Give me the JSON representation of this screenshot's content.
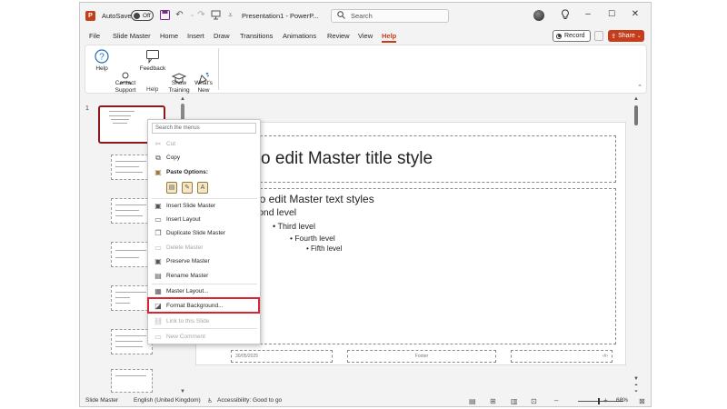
{
  "titlebar": {
    "app_logo": "P",
    "autosave_label": "AutoSave",
    "autosave_state": "Off",
    "doc_title": "Presentation1 - PowerP...",
    "search_placeholder": "Search",
    "quick_access_icons": [
      "save-icon",
      "undo-icon",
      "redo-icon",
      "slideshow-icon",
      "customize-icon"
    ],
    "window_controls": [
      "lightbulb-icon",
      "minimize-icon",
      "maximize-icon",
      "close-icon"
    ]
  },
  "menu": {
    "tabs": [
      "File",
      "Slide Master",
      "Home",
      "Insert",
      "Draw",
      "Transitions",
      "Animations",
      "Review",
      "View",
      "Help"
    ],
    "active_tab": "Help",
    "record_label": "Record",
    "share_label": "Share"
  },
  "ribbon": {
    "buttons": [
      {
        "label": "Help",
        "icon": "question-icon"
      },
      {
        "label": "Contact\nSupport",
        "icon": "contact-support-icon"
      },
      {
        "label": "Feedback",
        "icon": "feedback-icon"
      },
      {
        "label": "Show\nTraining",
        "icon": "training-icon"
      },
      {
        "label": "What's\nNew",
        "icon": "whats-new-icon"
      }
    ],
    "group_label": "Help"
  },
  "thumbnails": {
    "first_number": "1"
  },
  "slide": {
    "title": "k to edit Master title style",
    "levels": [
      "k to edit Master text styles",
      "econd level",
      "Third level",
      "Fourth level",
      "Fifth level"
    ],
    "footer_date": "30/05/2025",
    "footer_text": "Footer",
    "footer_page": "‹#›"
  },
  "context_menu": {
    "search_placeholder": "Search the menus",
    "items": [
      {
        "label": "Cut",
        "icon": "scissors-icon",
        "enabled": false
      },
      {
        "label": "Copy",
        "icon": "copy-icon",
        "enabled": true
      },
      {
        "label": "Paste Options:",
        "icon": "paste-icon",
        "enabled": true
      }
    ],
    "items2": [
      {
        "label": "Insert Slide Master",
        "icon": "insert-slide-master-icon",
        "enabled": true
      },
      {
        "label": "Insert Layout",
        "icon": "insert-layout-icon",
        "enabled": true
      },
      {
        "label": "Duplicate Slide Master",
        "icon": "duplicate-icon",
        "enabled": true
      },
      {
        "label": "Delete Master",
        "icon": "delete-icon",
        "enabled": false
      },
      {
        "label": "Preserve Master",
        "icon": "preserve-icon",
        "enabled": true
      },
      {
        "label": "Rename Master",
        "icon": "rename-icon",
        "enabled": true
      },
      {
        "label": "Master Layout...",
        "icon": "master-layout-icon",
        "enabled": true
      },
      {
        "label": "Format Background...",
        "icon": "format-background-icon",
        "enabled": true
      },
      {
        "label": "Link to this Slide",
        "icon": "link-icon",
        "enabled": false
      },
      {
        "label": "New Comment",
        "icon": "comment-icon",
        "enabled": false
      }
    ],
    "highlight_color": "#d9262c"
  },
  "statusbar": {
    "view_name": "Slide Master",
    "language": "English (United Kingdom)",
    "accessibility": "Accessibility: Good to go",
    "zoom": "68%"
  },
  "colors": {
    "accent": "#c43e1c",
    "selected_thumb_border": "#8b1a1a"
  }
}
